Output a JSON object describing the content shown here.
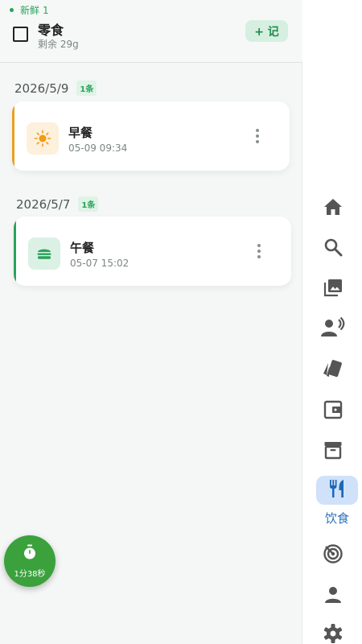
{
  "header": {
    "fresh_label": "新鲜",
    "fresh_count": "1",
    "item_name": "零食",
    "item_remain": "剩余 29g",
    "add_button": "+ 记"
  },
  "groups": [
    {
      "date": "2026/5/9",
      "badge": "1条",
      "entries": [
        {
          "title": "早餐",
          "time": "05-09 09:34",
          "icon": "sun-icon",
          "accent": "#e8a01f",
          "icon_bg": "#fdf0dc"
        }
      ]
    },
    {
      "date": "2026/5/7",
      "badge": "1条",
      "entries": [
        {
          "title": "午餐",
          "time": "05-07 15:02",
          "icon": "burger-icon",
          "accent": "#2aa35a",
          "icon_bg": "#dcf1e5"
        }
      ]
    }
  ],
  "timer": {
    "label": "1分38秒",
    "icon": "stopwatch-icon"
  },
  "rail": {
    "items": [
      "home-icon",
      "search-icon",
      "gallery-icon",
      "voice-person-icon",
      "cards-icon",
      "wallet-icon",
      "archive-icon",
      "food-icon",
      "radar-icon",
      "person-icon",
      "gear-icon"
    ],
    "active_label": "饮食"
  },
  "colors": {
    "accent_green": "#2aa35a",
    "accent_orange": "#e8a01f",
    "rail_active_bg": "#cfe2fa",
    "rail_active_text": "#2a6fb8",
    "fab_green": "#3ba13c"
  }
}
